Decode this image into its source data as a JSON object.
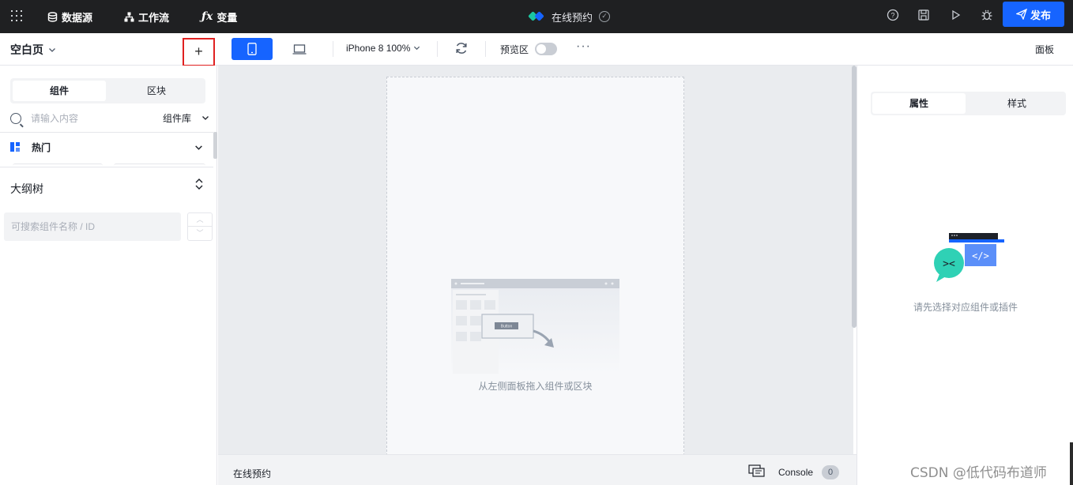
{
  "topbar": {
    "nav": [
      {
        "label": "数据源",
        "icon": "database-icon"
      },
      {
        "label": "工作流",
        "icon": "workflow-icon"
      },
      {
        "label": "变量",
        "icon": "fx-icon"
      }
    ],
    "app_title": "在线预约",
    "publish_label": "发布",
    "icons": [
      "help-icon",
      "save-icon",
      "play-icon",
      "debug-icon",
      "send-icon"
    ]
  },
  "toolbar": {
    "page_name": "空白页",
    "add_symbol": "+",
    "device_label": "iPhone 8 100%",
    "preview_label": "预览区",
    "more_symbol": "···",
    "panel_label": "面板"
  },
  "left_panel": {
    "tabs": [
      "组件",
      "区块"
    ],
    "search_placeholder": "请输入内容",
    "library_label": "组件库",
    "category_label": "热门",
    "outline_title": "大纲树",
    "outline_search_placeholder": "可搜索组件名称 / ID"
  },
  "canvas": {
    "empty_text": "从左侧面板拖入组件或区块",
    "illustration_button": "Button"
  },
  "statusbar": {
    "title": "在线预约",
    "console_label": "Console",
    "console_count": "0"
  },
  "right_panel": {
    "tabs": [
      "属性",
      "样式"
    ],
    "hint": "请先选择对应组件或插件"
  },
  "watermark": "CSDN @低代码布道师",
  "colors": {
    "accent": "#1664ff",
    "topbar": "#1f2022",
    "canvas_bg": "#eaecef"
  }
}
